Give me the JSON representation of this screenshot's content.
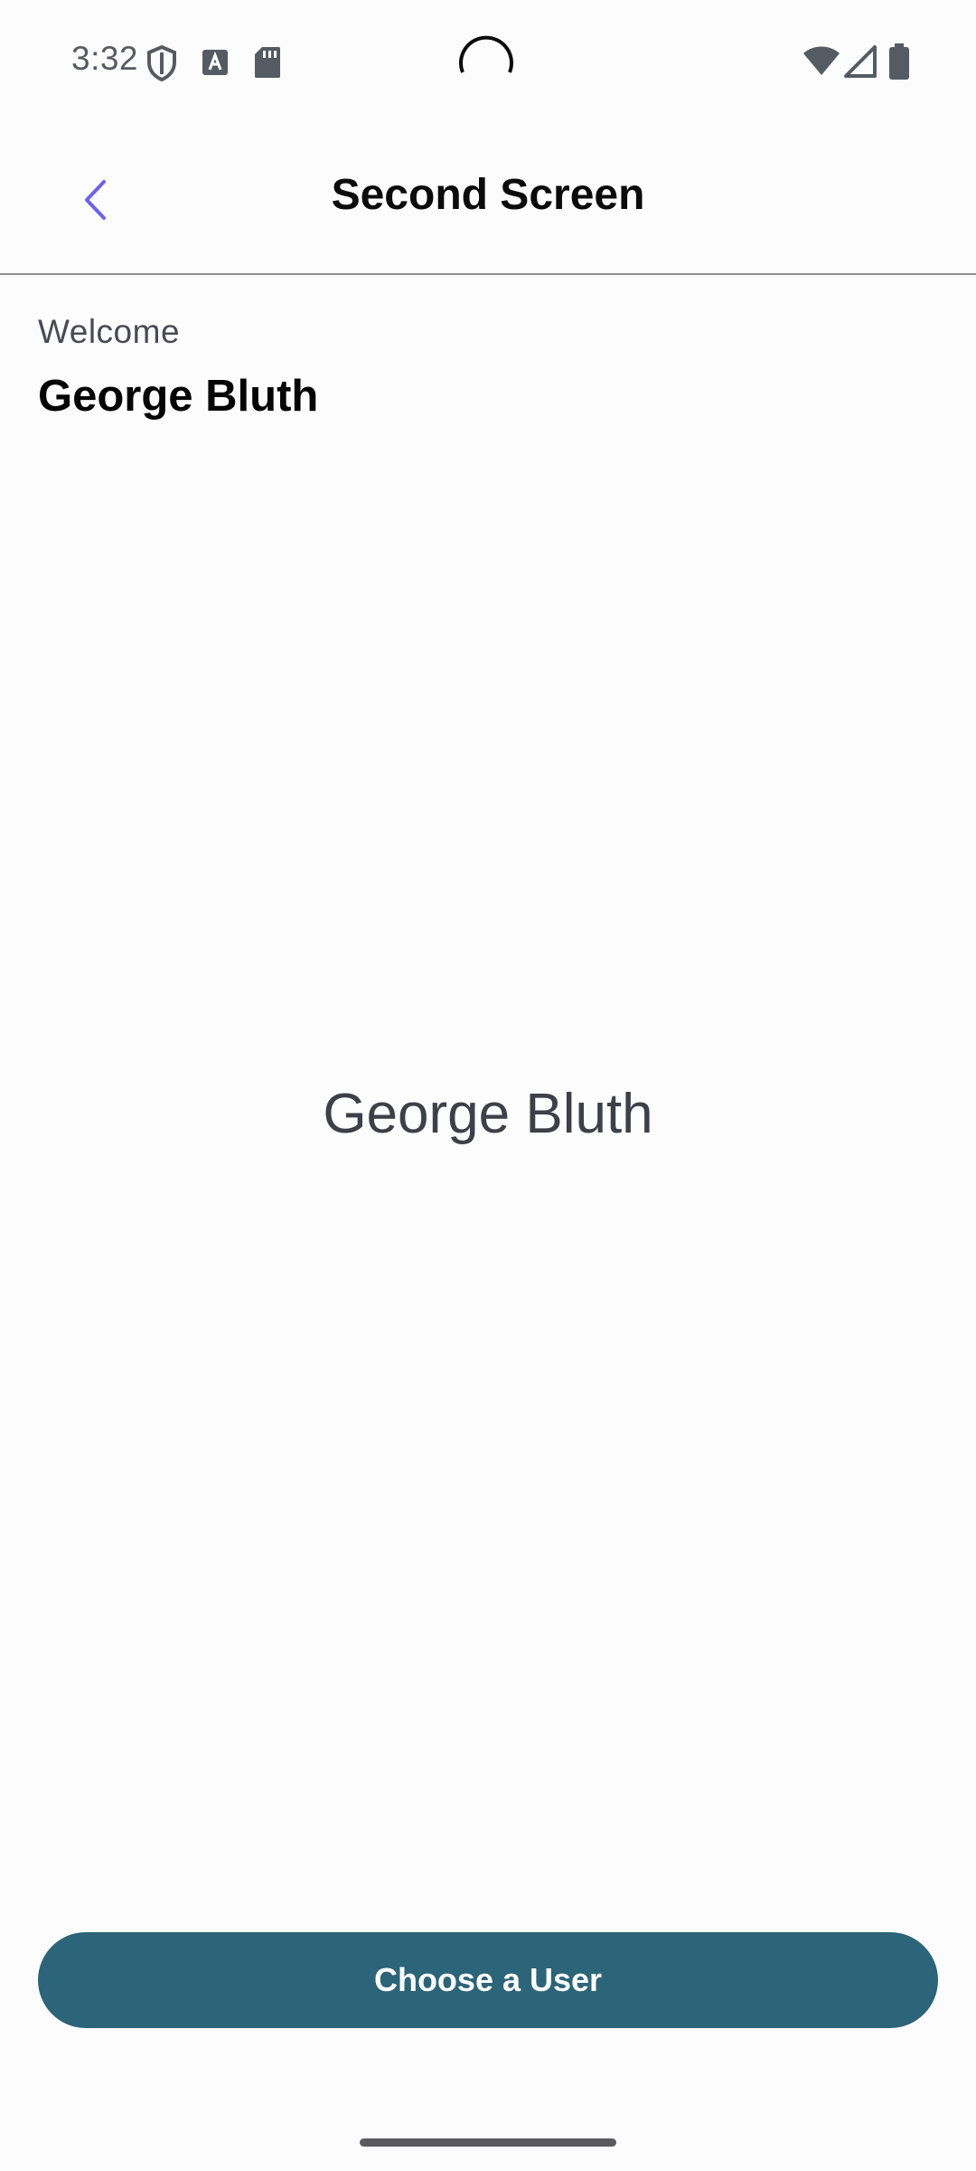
{
  "status_bar": {
    "time": "3:32",
    "icons": [
      "shield-icon",
      "font-a-icon",
      "sd-card-icon",
      "wifi-icon",
      "cellular-signal-icon",
      "battery-icon"
    ]
  },
  "app_bar": {
    "title": "Second Screen",
    "back_icon": "chevron-left-icon"
  },
  "welcome": {
    "label": "Welcome",
    "name": "George Bluth"
  },
  "selected_user": {
    "name": "George Bluth"
  },
  "actions": {
    "choose_user_label": "Choose a User"
  },
  "colors": {
    "accent_back": "#6d63e6",
    "button_bg": "#2c6479",
    "text_primary": "#050506",
    "text_secondary": "#4a4a55"
  }
}
